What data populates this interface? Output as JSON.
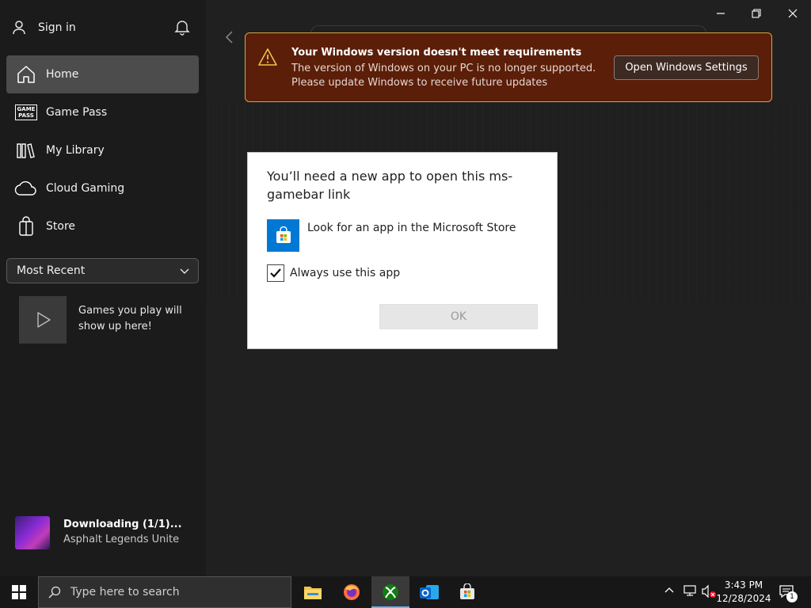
{
  "sidebar": {
    "sign_in": "Sign in",
    "nav": [
      {
        "label": "Home",
        "icon": "home-icon",
        "active": true
      },
      {
        "label": "Game Pass",
        "icon": "gamepass-icon"
      },
      {
        "label": "My Library",
        "icon": "library-icon"
      },
      {
        "label": "Cloud Gaming",
        "icon": "cloud-icon"
      },
      {
        "label": "Store",
        "icon": "store-bag-icon"
      }
    ],
    "gamepass_icon_text": "GAME PASS",
    "filter": "Most Recent",
    "recent_placeholder": "Games you play will show up here!",
    "download": {
      "title": "Downloading (1/1)...",
      "game": "Asphalt Legends Unite"
    }
  },
  "banner": {
    "title": "Your Windows version doesn't meet requirements",
    "line1": "The version of Windows on your PC is no longer supported.",
    "line2": "Please update Windows to receive future updates",
    "button": "Open Windows Settings",
    "accent": "#d8a540"
  },
  "dialog": {
    "title": "You’ll need a new app to open this ms-gamebar link",
    "option": "Look for an app in the Microsoft Store",
    "checkbox_label": "Always use this app",
    "checkbox_checked": true,
    "ok": "OK"
  },
  "taskbar": {
    "search_placeholder": "Type here to search",
    "time": "3:43 PM",
    "date": "12/28/2024",
    "notification_count": "1"
  }
}
